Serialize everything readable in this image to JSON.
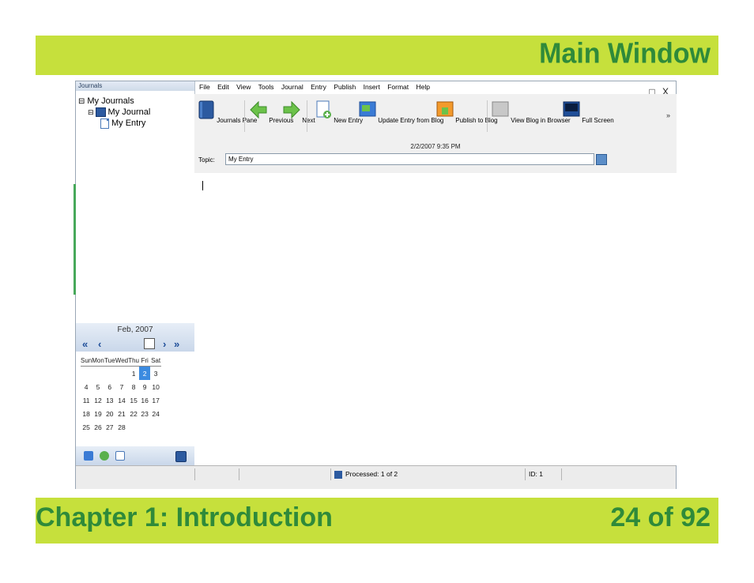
{
  "slide": {
    "title": "Main Window",
    "chapter": "Chapter 1: Introduction",
    "pages": "24 of 92"
  },
  "journals_pane": {
    "header": "Journals",
    "tree": [
      {
        "label": "My Journals",
        "expander": "⊟"
      },
      {
        "label": "My Journal",
        "expander": "⊟"
      },
      {
        "label": "My Entry"
      }
    ]
  },
  "menu": [
    "File",
    "Edit",
    "View",
    "Tools",
    "Journal",
    "Entry",
    "Publish",
    "Insert",
    "Format",
    "Help"
  ],
  "window_controls": "_ □ X",
  "toolbar": [
    {
      "label": "Journals Pane",
      "icon": "journal-icon"
    },
    {
      "label": "Previous",
      "icon": "arrow-left-icon"
    },
    {
      "label": "Next",
      "icon": "arrow-right-icon"
    },
    {
      "label": "New Entry",
      "icon": "new-entry-icon"
    },
    {
      "label": "Update Entry from Blog",
      "icon": "update-entry-icon"
    },
    {
      "label": "Publish to Blog",
      "icon": "publish-icon"
    },
    {
      "label": "View Blog in Browser",
      "icon": "browser-icon"
    },
    {
      "label": "Full Screen",
      "icon": "fullscreen-icon"
    }
  ],
  "toolbar_overflow": "»",
  "entry": {
    "date": "2/2/2007 9:35 PM",
    "topic_label": "Topic:",
    "topic_value": "My Entry"
  },
  "calendar": {
    "month": "Feb, 2007",
    "nav_prev_year": "«",
    "nav_prev": "‹",
    "nav_next": "›",
    "nav_next_year": "»",
    "weekdays": [
      "Sun",
      "Mon",
      "Tue",
      "Wed",
      "Thu",
      "Fri",
      "Sat"
    ],
    "weeks": [
      [
        "",
        "",
        "",
        "",
        "1",
        "2",
        "3"
      ],
      [
        "4",
        "5",
        "6",
        "7",
        "8",
        "9",
        "10"
      ],
      [
        "11",
        "12",
        "13",
        "14",
        "15",
        "16",
        "17"
      ],
      [
        "18",
        "19",
        "20",
        "21",
        "22",
        "23",
        "24"
      ],
      [
        "25",
        "26",
        "27",
        "28",
        "",
        "",
        ""
      ]
    ],
    "selected_day": "2"
  },
  "status_bar": {
    "processed": "Processed: 1 of 2",
    "id": "ID: 1"
  },
  "colors": {
    "slide_bar": "#c6e03c",
    "slide_text": "#2f8a3a",
    "selected_day": "#3c8be0"
  }
}
